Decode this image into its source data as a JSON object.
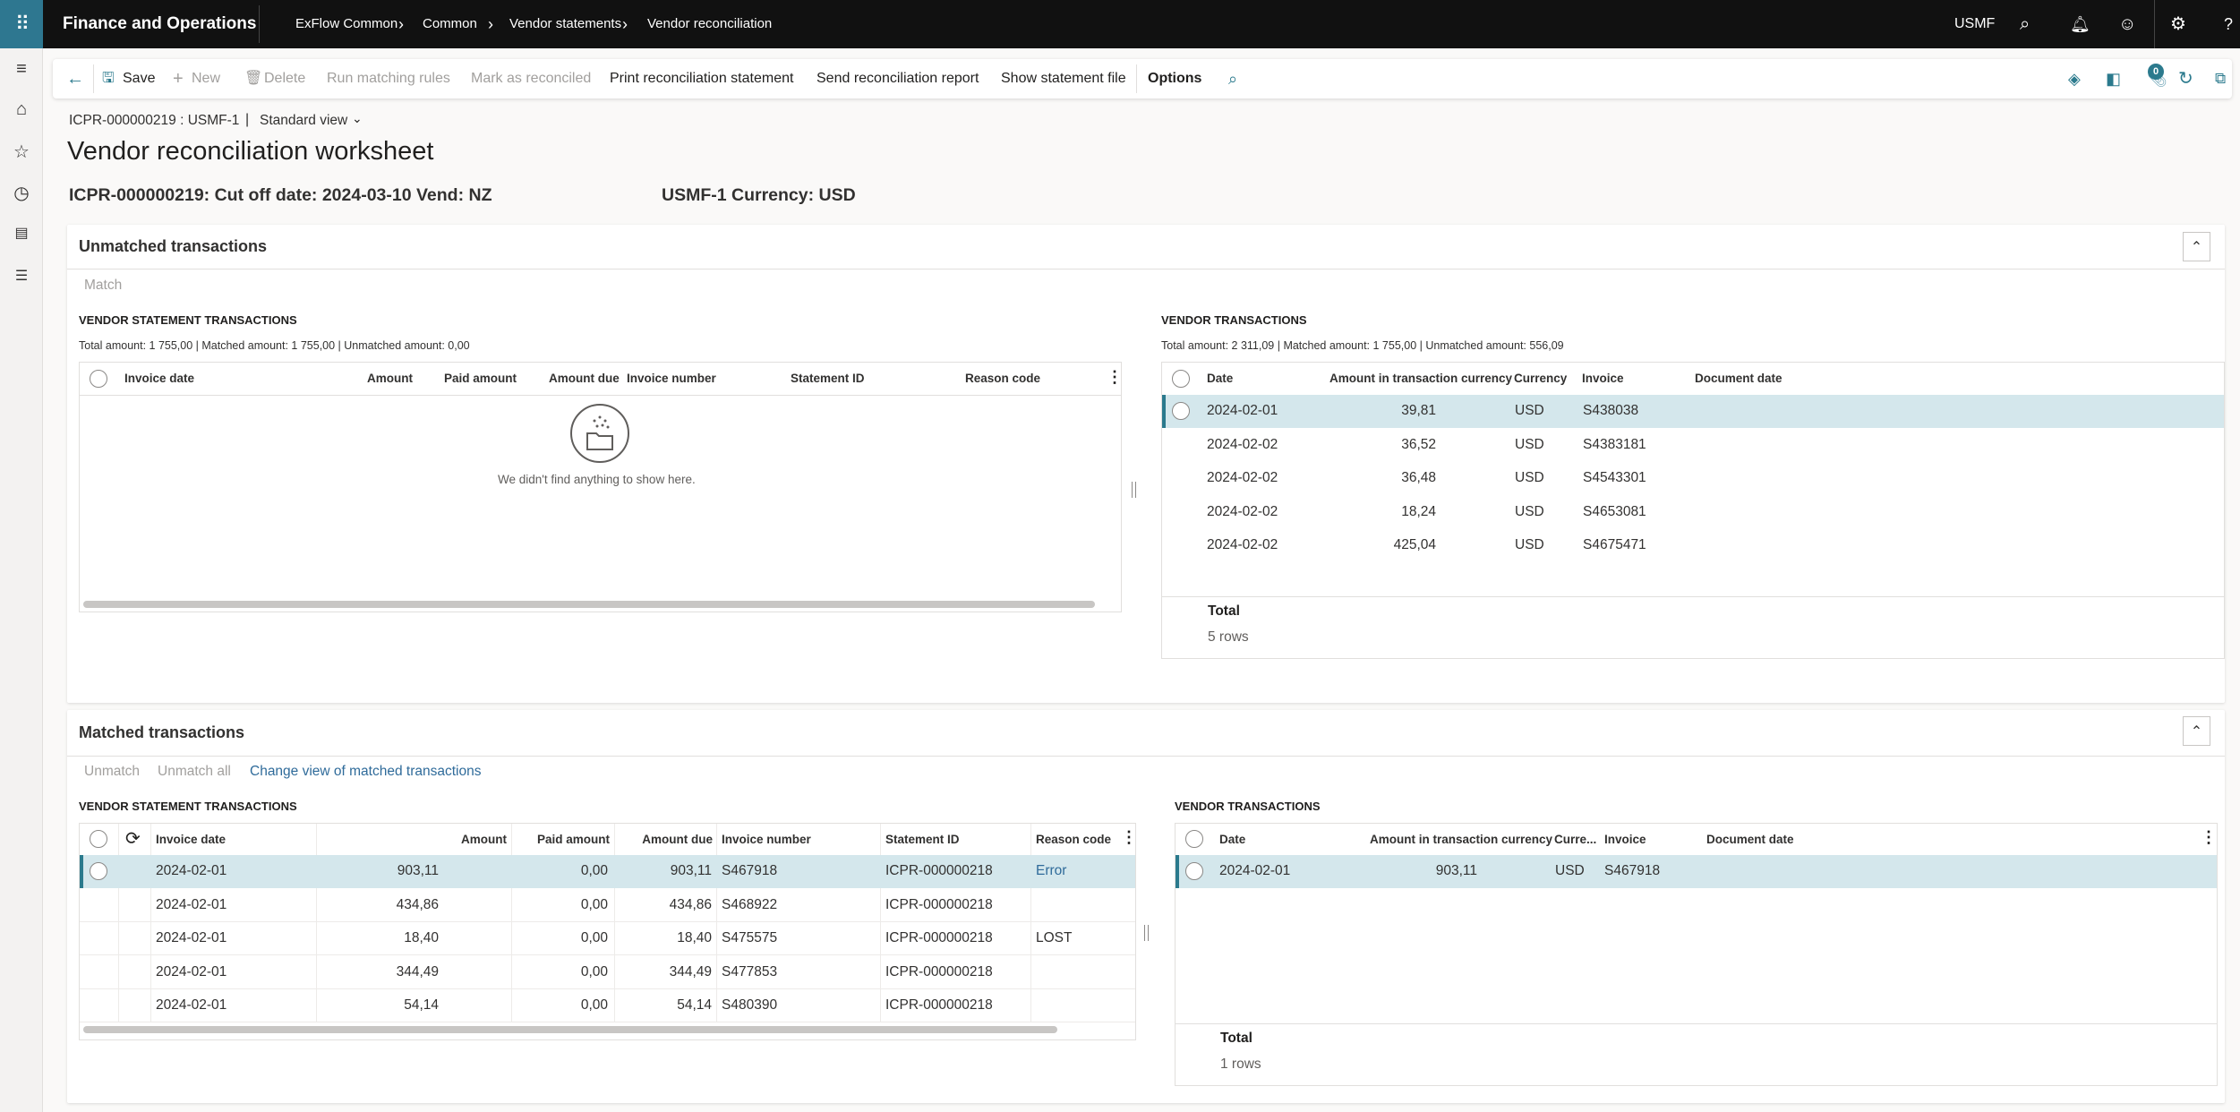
{
  "app": {
    "title": "Finance and Operations",
    "breadcrumbs": [
      "ExFlow Common",
      "Common",
      "Vendor statements",
      "Vendor reconciliation"
    ],
    "company": "USMF",
    "icons": [
      "waffle-icon",
      "search-icon",
      "bell-icon",
      "smiley-icon",
      "gear-icon",
      "help-icon"
    ]
  },
  "rail": {
    "icons": [
      "hamburger-icon",
      "home-icon",
      "star-icon",
      "clock-icon",
      "workspace-icon",
      "list-icon"
    ]
  },
  "toolbar": {
    "back": "←",
    "save": "Save",
    "new": "New",
    "delete": "Delete",
    "run_matching_rules": "Run matching rules",
    "mark_as_reconciled": "Mark as reconciled",
    "print": "Print reconciliation statement",
    "send": "Send reconciliation report",
    "show_file": "Show statement file",
    "options": "Options",
    "attachments_count": "0"
  },
  "page": {
    "record": "ICPR-000000219 : USMF-1",
    "separator": "|",
    "view": "Standard view",
    "title": "Vendor reconciliation worksheet",
    "subtitle_left": "ICPR-000000219: Cut off date: 2024-03-10 Vend: NZ",
    "subtitle_right": "USMF-1 Currency: USD"
  },
  "unmatched": {
    "title": "Unmatched transactions",
    "match": "Match",
    "statement": {
      "heading": "VENDOR STATEMENT TRANSACTIONS",
      "summary": "Total amount: 1 755,00 | Matched amount: 1 755,00 | Unmatched amount: 0,00",
      "columns": [
        "Invoice date",
        "Amount",
        "Paid amount",
        "Amount due",
        "Invoice number",
        "Statement ID",
        "Reason code"
      ],
      "empty": "We didn't find anything to show here."
    },
    "vendor": {
      "heading": "VENDOR TRANSACTIONS",
      "summary": "Total amount: 2 311,09 | Matched amount: 1 755,00 | Unmatched amount: 556,09",
      "columns": [
        "Date",
        "Amount in transaction currency",
        "Currency",
        "Invoice",
        "Document date"
      ],
      "rows": [
        [
          "2024-02-01",
          "39,81",
          "USD",
          "S438038",
          ""
        ],
        [
          "2024-02-02",
          "36,52",
          "USD",
          "S4383181",
          ""
        ],
        [
          "2024-02-02",
          "36,48",
          "USD",
          "S4543301",
          ""
        ],
        [
          "2024-02-02",
          "18,24",
          "USD",
          "S4653081",
          ""
        ],
        [
          "2024-02-02",
          "425,04",
          "USD",
          "S4675471",
          ""
        ]
      ],
      "total_label": "Total",
      "total_rows": "5 rows"
    }
  },
  "matched": {
    "title": "Matched transactions",
    "unmatch": "Unmatch",
    "unmatch_all": "Unmatch all",
    "change_view": "Change view of matched transactions",
    "statement": {
      "heading": "VENDOR STATEMENT TRANSACTIONS",
      "columns": [
        "Invoice date",
        "Amount",
        "Paid amount",
        "Amount due",
        "Invoice number",
        "Statement ID",
        "Reason code"
      ],
      "rows": [
        [
          "2024-02-01",
          "903,11",
          "0,00",
          "903,11",
          "S467918",
          "ICPR-000000218",
          "Error"
        ],
        [
          "2024-02-01",
          "434,86",
          "0,00",
          "434,86",
          "S468922",
          "ICPR-000000218",
          ""
        ],
        [
          "2024-02-01",
          "18,40",
          "0,00",
          "18,40",
          "S475575",
          "ICPR-000000218",
          "LOST"
        ],
        [
          "2024-02-01",
          "344,49",
          "0,00",
          "344,49",
          "S477853",
          "ICPR-000000218",
          ""
        ],
        [
          "2024-02-01",
          "54,14",
          "0,00",
          "54,14",
          "S480390",
          "ICPR-000000218",
          ""
        ]
      ]
    },
    "vendor": {
      "heading": "VENDOR TRANSACTIONS",
      "columns": [
        "Date",
        "Amount in transaction currency",
        "Curre...",
        "Invoice",
        "Document date"
      ],
      "rows": [
        [
          "2024-02-01",
          "903,11",
          "USD",
          "S467918",
          ""
        ]
      ],
      "total_label": "Total",
      "total_rows": "1 rows"
    }
  },
  "colors": {
    "accent": "#2b7a8d",
    "selected_row": "#d4e7ec",
    "topbar": "#111111",
    "link": "#2f6b9a"
  }
}
